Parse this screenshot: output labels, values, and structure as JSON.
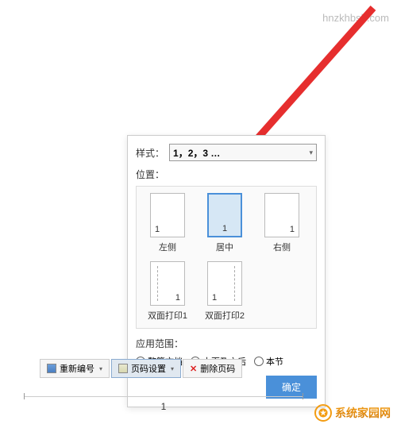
{
  "watermark": "hnzkhbsb.com",
  "dialog": {
    "style_label": "样式：",
    "style_value": "1，2，3 …",
    "position_label": "位置：",
    "options": {
      "left": {
        "label": "左侧",
        "number": "1"
      },
      "center": {
        "label": "居中",
        "number": "1"
      },
      "right": {
        "label": "右侧",
        "number": "1"
      },
      "duplex1": {
        "label": "双面打印1",
        "number": "1"
      },
      "duplex2": {
        "label": "双面打印2",
        "number": "1"
      }
    },
    "scope_label": "应用范围：",
    "scope_options": {
      "whole": "整篇文档",
      "from_here": "本页及之后",
      "section": "本节"
    },
    "confirm": "确定"
  },
  "toolbar": {
    "renumber": "重新编号",
    "settings": "页码设置",
    "delete": "删除页码"
  },
  "doc_page_number": "1",
  "logo": "系统家园网"
}
